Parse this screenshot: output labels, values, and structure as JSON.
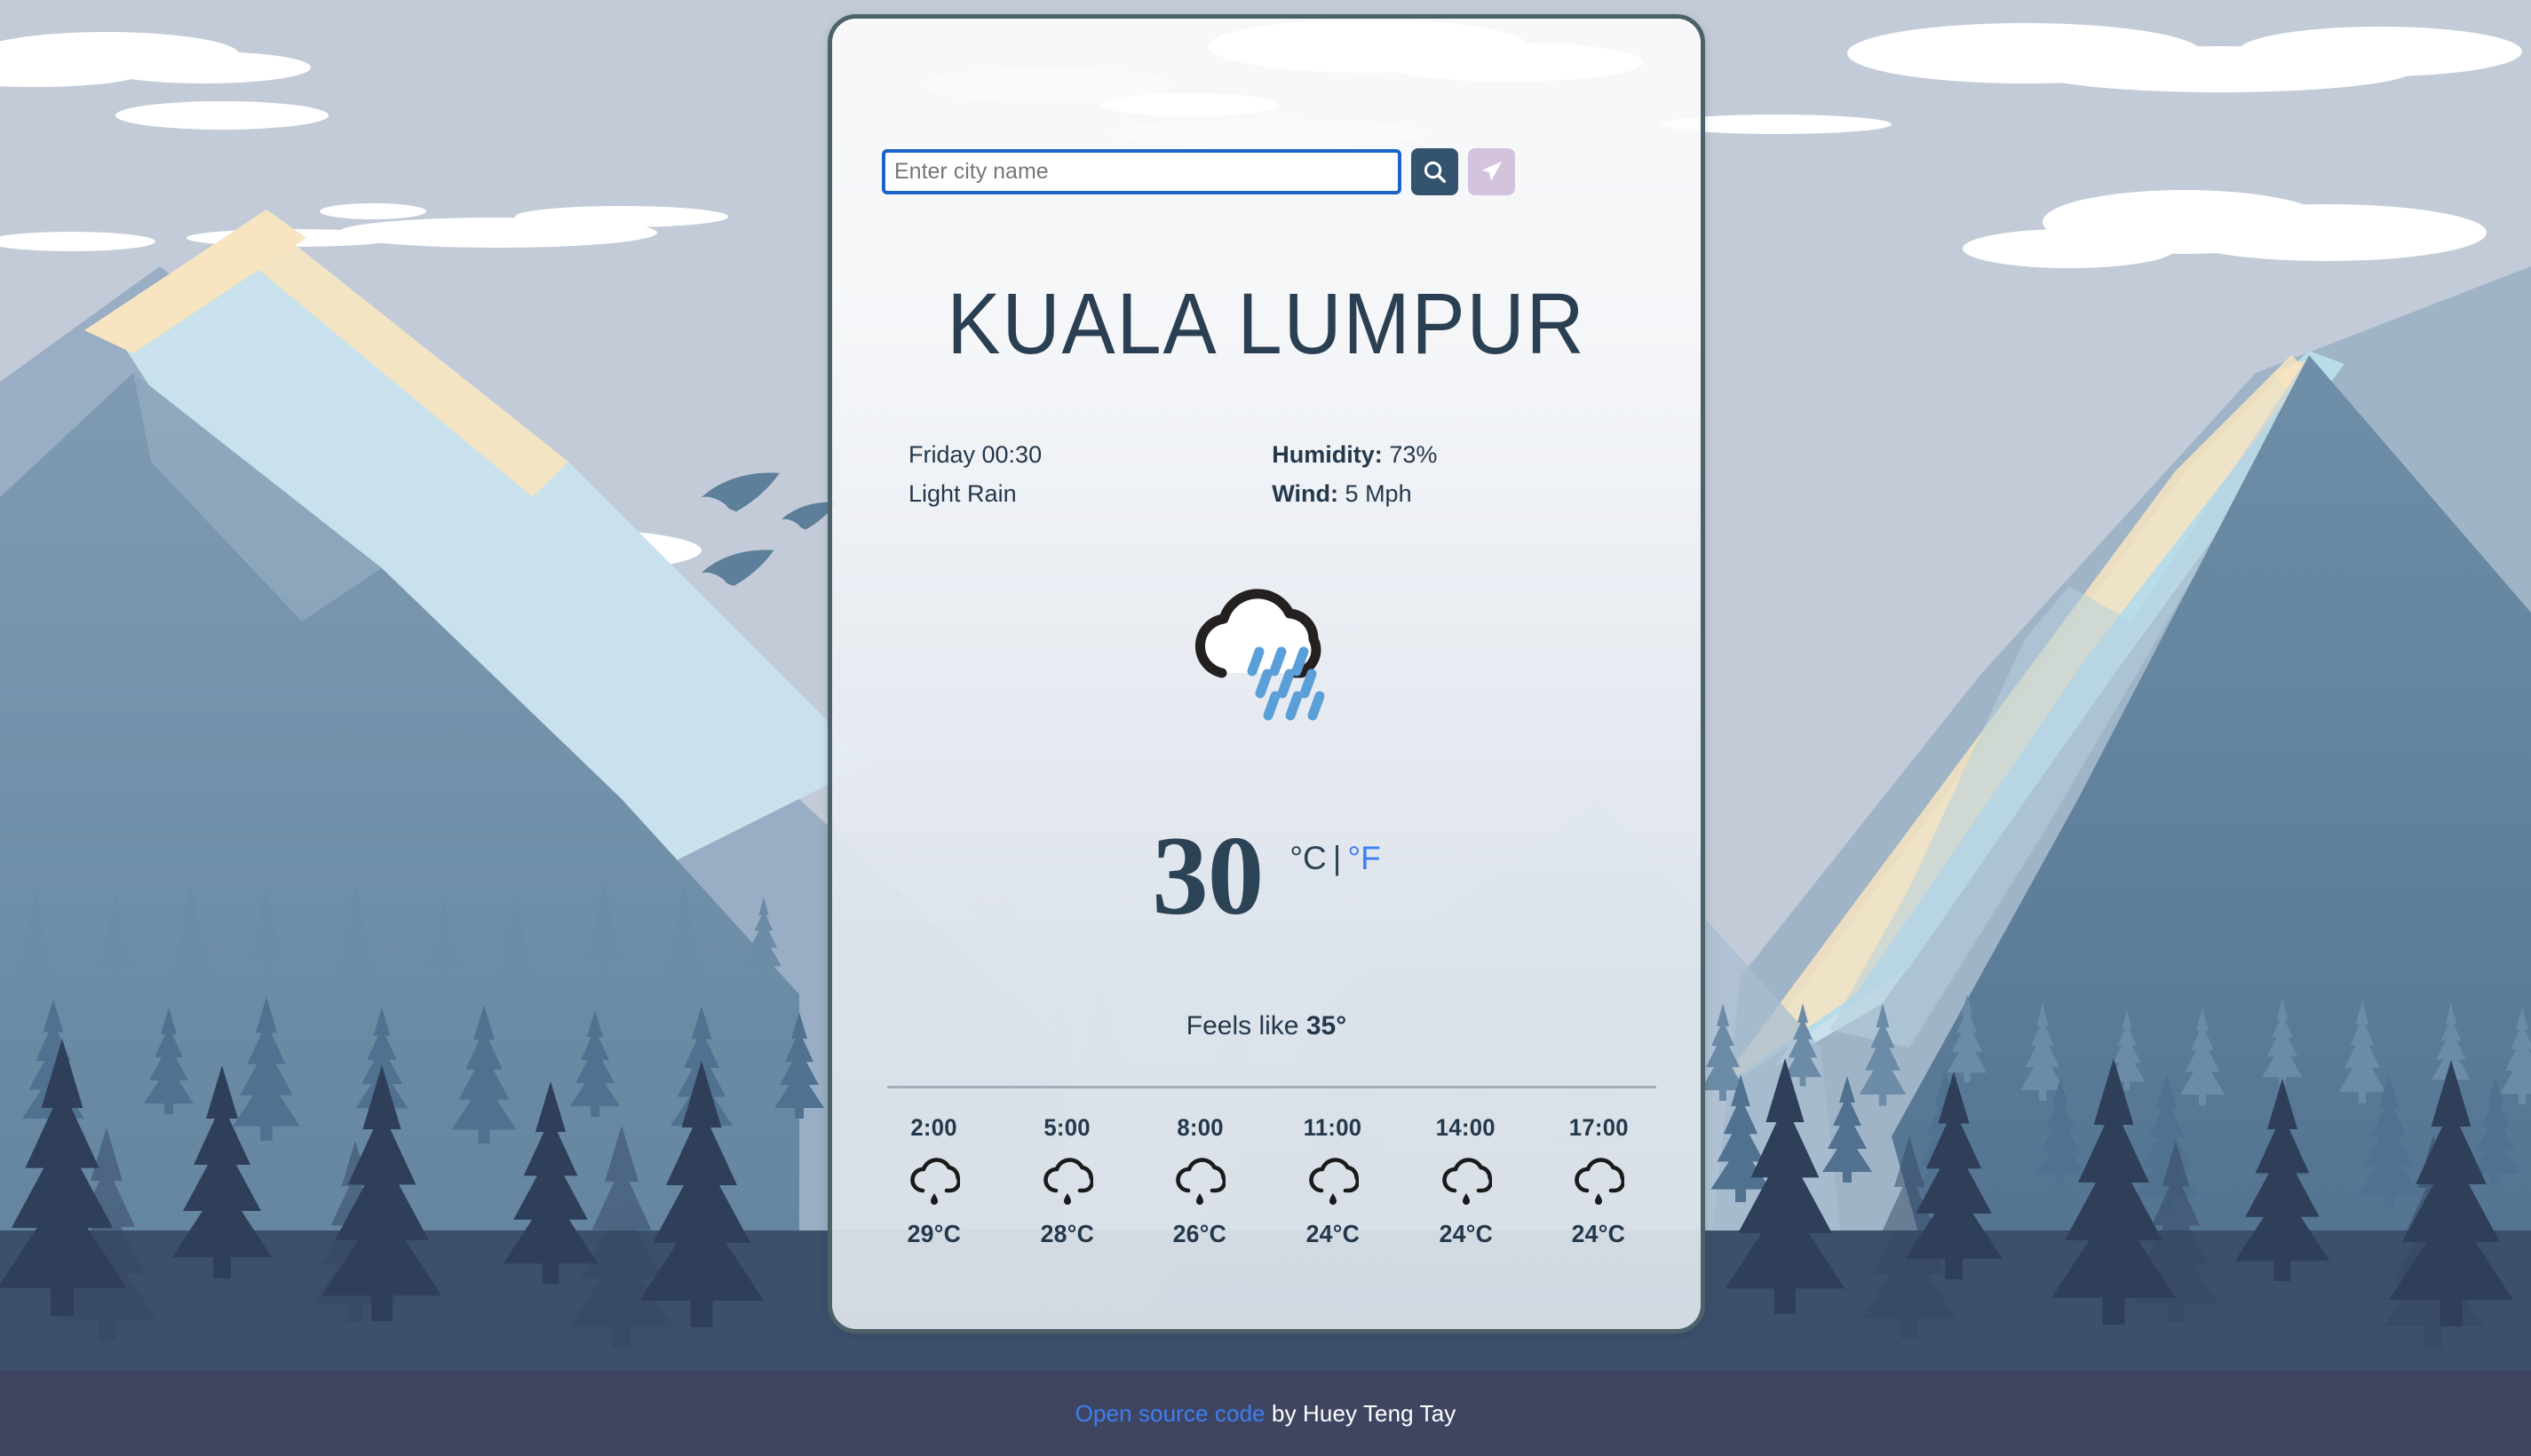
{
  "search": {
    "placeholder": "Enter city name",
    "value": "",
    "search_button_label": "Search",
    "locate_button_label": "Use my location"
  },
  "current": {
    "city": "KUALA LUMPUR",
    "day_time": "Friday 00:30",
    "condition": "Light Rain",
    "humidity_label": "Humidity:",
    "humidity_value": "73%",
    "wind_label": "Wind:",
    "wind_value": "5 Mph",
    "temperature": "30",
    "unit_celsius": "°C",
    "unit_separator": "|",
    "unit_fahrenheit": "°F",
    "feels_like_prefix": "Feels like",
    "feels_like_value": "35°",
    "icon": "rain-cloud-icon"
  },
  "hourly": [
    {
      "time": "2:00",
      "temp": "29°C",
      "icon": "cloud-drizzle-icon"
    },
    {
      "time": "5:00",
      "temp": "28°C",
      "icon": "cloud-drizzle-icon"
    },
    {
      "time": "8:00",
      "temp": "26°C",
      "icon": "cloud-drizzle-icon"
    },
    {
      "time": "11:00",
      "temp": "24°C",
      "icon": "cloud-drizzle-icon"
    },
    {
      "time": "14:00",
      "temp": "24°C",
      "icon": "cloud-drizzle-icon"
    },
    {
      "time": "17:00",
      "temp": "24°C",
      "icon": "cloud-drizzle-icon"
    }
  ],
  "footer": {
    "link_text": "Open source code",
    "credit_text": " by Huey Teng Tay"
  },
  "colors": {
    "accent_blue": "#3d7ef0",
    "title_navy": "#2b3f52",
    "search_button": "#34536e",
    "locate_button": "#d3c3dd",
    "card_border": "#4c6268",
    "footer_band": "#3f4561",
    "rain_blue": "#5a9fd8",
    "sky": "#c3cbd9"
  }
}
